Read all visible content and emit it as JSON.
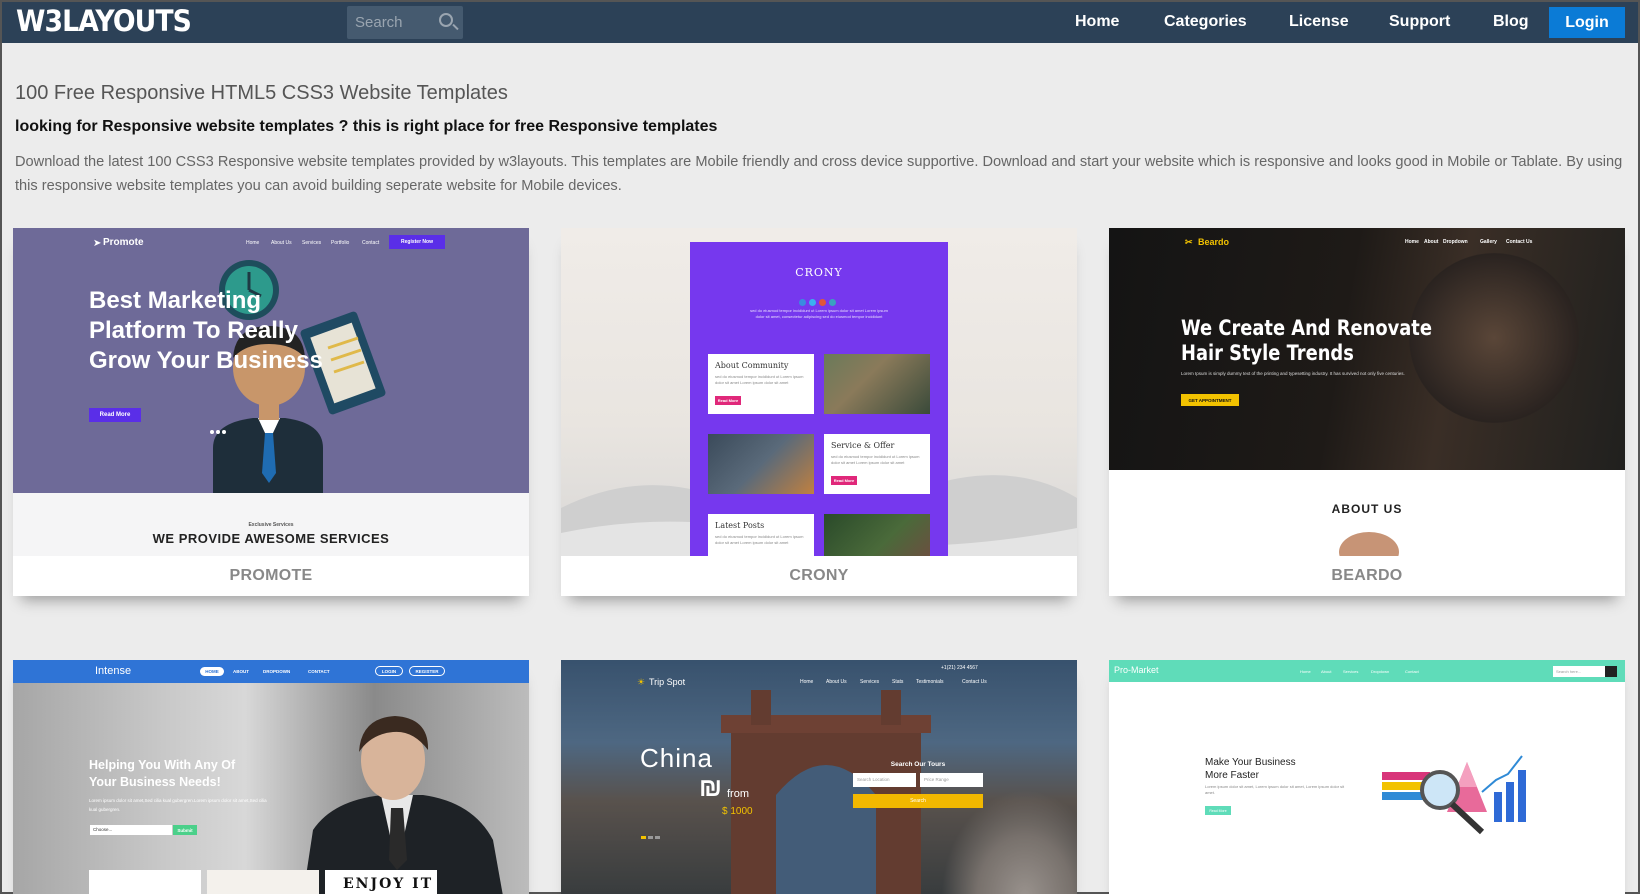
{
  "header": {
    "logo": "W3LAYOUTS",
    "search_placeholder": "Search",
    "nav": [
      "Home",
      "Categories",
      "License",
      "Support",
      "Blog"
    ],
    "login": "Login"
  },
  "intro": {
    "title": "100 Free Responsive HTML5 CSS3 Website Templates",
    "subtitle": "looking for Responsive website templates ? this is right place for free Responsive templates",
    "description": "Download the latest 100 CSS3 Responsive website templates provided by w3layouts. This templates are Mobile friendly and cross device supportive. Download and start your website which is responsive and looks good in Mobile or Tablate. By using this responsive website templates you can avoid building seperate website for Mobile devices."
  },
  "templates": {
    "promote": {
      "name": "PROMOTE",
      "brand": "Promote",
      "nav": [
        "Home",
        "About Us",
        "Services",
        "Portfolio",
        "Contact"
      ],
      "register": "Register Now",
      "headline": "Best Marketing Platform To Really Grow Your Business",
      "read_more": "Read More",
      "exclusive": "Exclusive Services",
      "services": "WE PROVIDE AWESOME SERVICES"
    },
    "crony": {
      "name": "CRONY",
      "brand": "CRONY",
      "intro": "sed do eiusmod tempor incididunt ut Lorem ipsum dolor sit amet Lorem ipsum dolor sit amet, consectetur adipiscing sed do eiusmod tempor incididunt",
      "about": "About Community",
      "service": "Service & Offer",
      "posts": "Latest Posts",
      "read_more": "Read More",
      "lorem": "sed do eiusmod tempor incididunt ut Lorem ipsum dolor sit amet Lorem ipsum dolor sit amet"
    },
    "beardo": {
      "name": "BEARDO",
      "brand": "Beardo",
      "nav": [
        "Home",
        "About",
        "Dropdown",
        "Gallery",
        "Contact Us"
      ],
      "headline_1": "We Create And Renovate",
      "headline_2": "Hair Style Trends",
      "lorem": "Lorem Ipsum is simply dummy text of the printing and typesetting industry. It has survived not only five centuries.",
      "cta": "GET APPOINTMENT",
      "about": "ABOUT US"
    },
    "intense": {
      "brand": "Intense",
      "nav": [
        "HOME",
        "ABOUT",
        "DROPDOWN",
        "CONTACT"
      ],
      "login": "LOGIN",
      "register": "REGISTER",
      "headline_1": "Helping You With Any Of",
      "headline_2": "Your Business Needs!",
      "lorem": "Lorem ipsum dolor sit amet,Sed cilia kual gubergren.Lorem ipsum dolor sit amet,Sed cilia kual gubergren.",
      "choose": "Choose...",
      "submit": "Submit",
      "enjoy": "ENJOY IT"
    },
    "tripspot": {
      "brand": "Trip Spot",
      "phone": "+1(21) 234 4567",
      "nav": [
        "Home",
        "About Us",
        "Services",
        "Stats",
        "Testimonials",
        "Contact Us"
      ],
      "city": "China",
      "from": "from",
      "price": "$ 1000",
      "search_title": "Search Our Tours",
      "location": "Search Location",
      "price_range": "Price Range",
      "search": "Search"
    },
    "promarket": {
      "brand": "Pro-Market",
      "nav": [
        "Home",
        "About",
        "Services",
        "Dropdown",
        "Contact"
      ],
      "search": "Search here...",
      "headline_1": "Make Your Business",
      "headline_2": "More Faster",
      "lorem": "Lorem ipsum dolor sit amet, Lorem ipsum dolor sit amet, Lorem ipsum dolor sit amet.",
      "read_more": "Read More"
    }
  }
}
